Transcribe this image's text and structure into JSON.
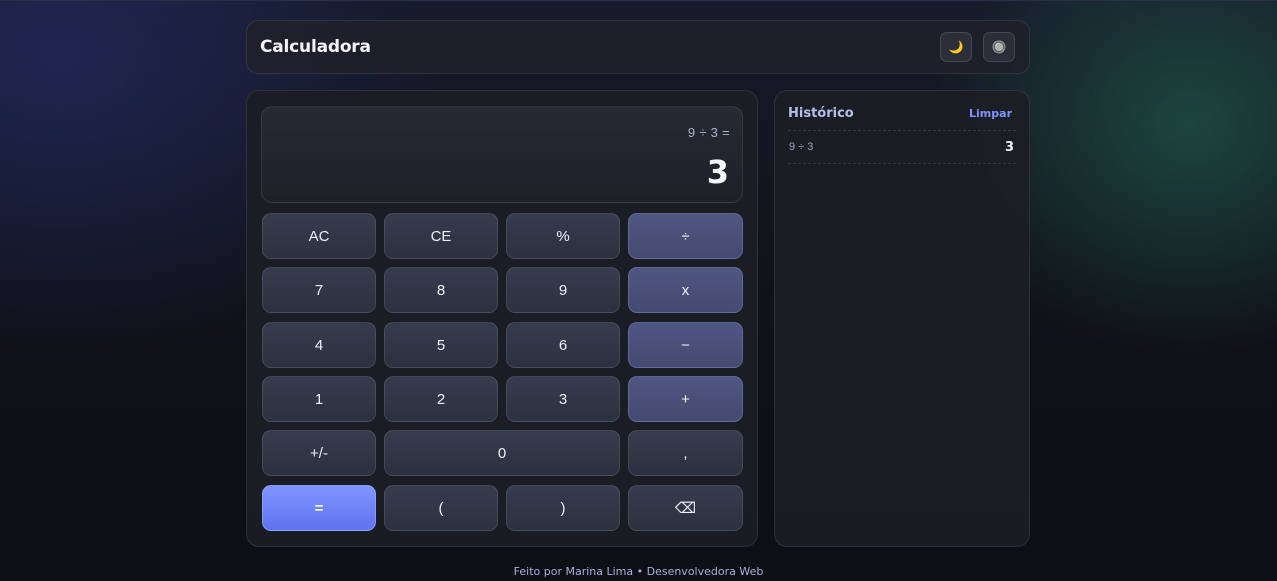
{
  "header": {
    "title": "Calculadora",
    "theme_icon": "crescent-moon-icon",
    "theme_glyph": "🌙",
    "settings_icon": "dial-icon",
    "settings_glyph": "🔘"
  },
  "display": {
    "expression": "9 ÷ 3 =",
    "result": "3"
  },
  "keys": {
    "ac": "AC",
    "ce": "CE",
    "percent": "%",
    "divide": "÷",
    "seven": "7",
    "eight": "8",
    "nine": "9",
    "multiply": "x",
    "four": "4",
    "five": "5",
    "six": "6",
    "minus": "−",
    "one": "1",
    "two": "2",
    "three": "3",
    "plus": "+",
    "sign": "+/-",
    "zero": "0",
    "comma": ",",
    "equals": "=",
    "open_paren": "(",
    "close_paren": ")",
    "backspace": "⌫"
  },
  "history": {
    "title": "Histórico",
    "clear_label": "Limpar",
    "items": [
      {
        "expression": "9 ÷ 3",
        "result": "3"
      }
    ]
  },
  "footer": {
    "text": "Feito por Marina Lima • Desenvolvedora Web"
  },
  "colors": {
    "accent": "#6f84fa",
    "operator_key": "#4a5079",
    "number_key": "#323848",
    "background": "#0f1117"
  }
}
